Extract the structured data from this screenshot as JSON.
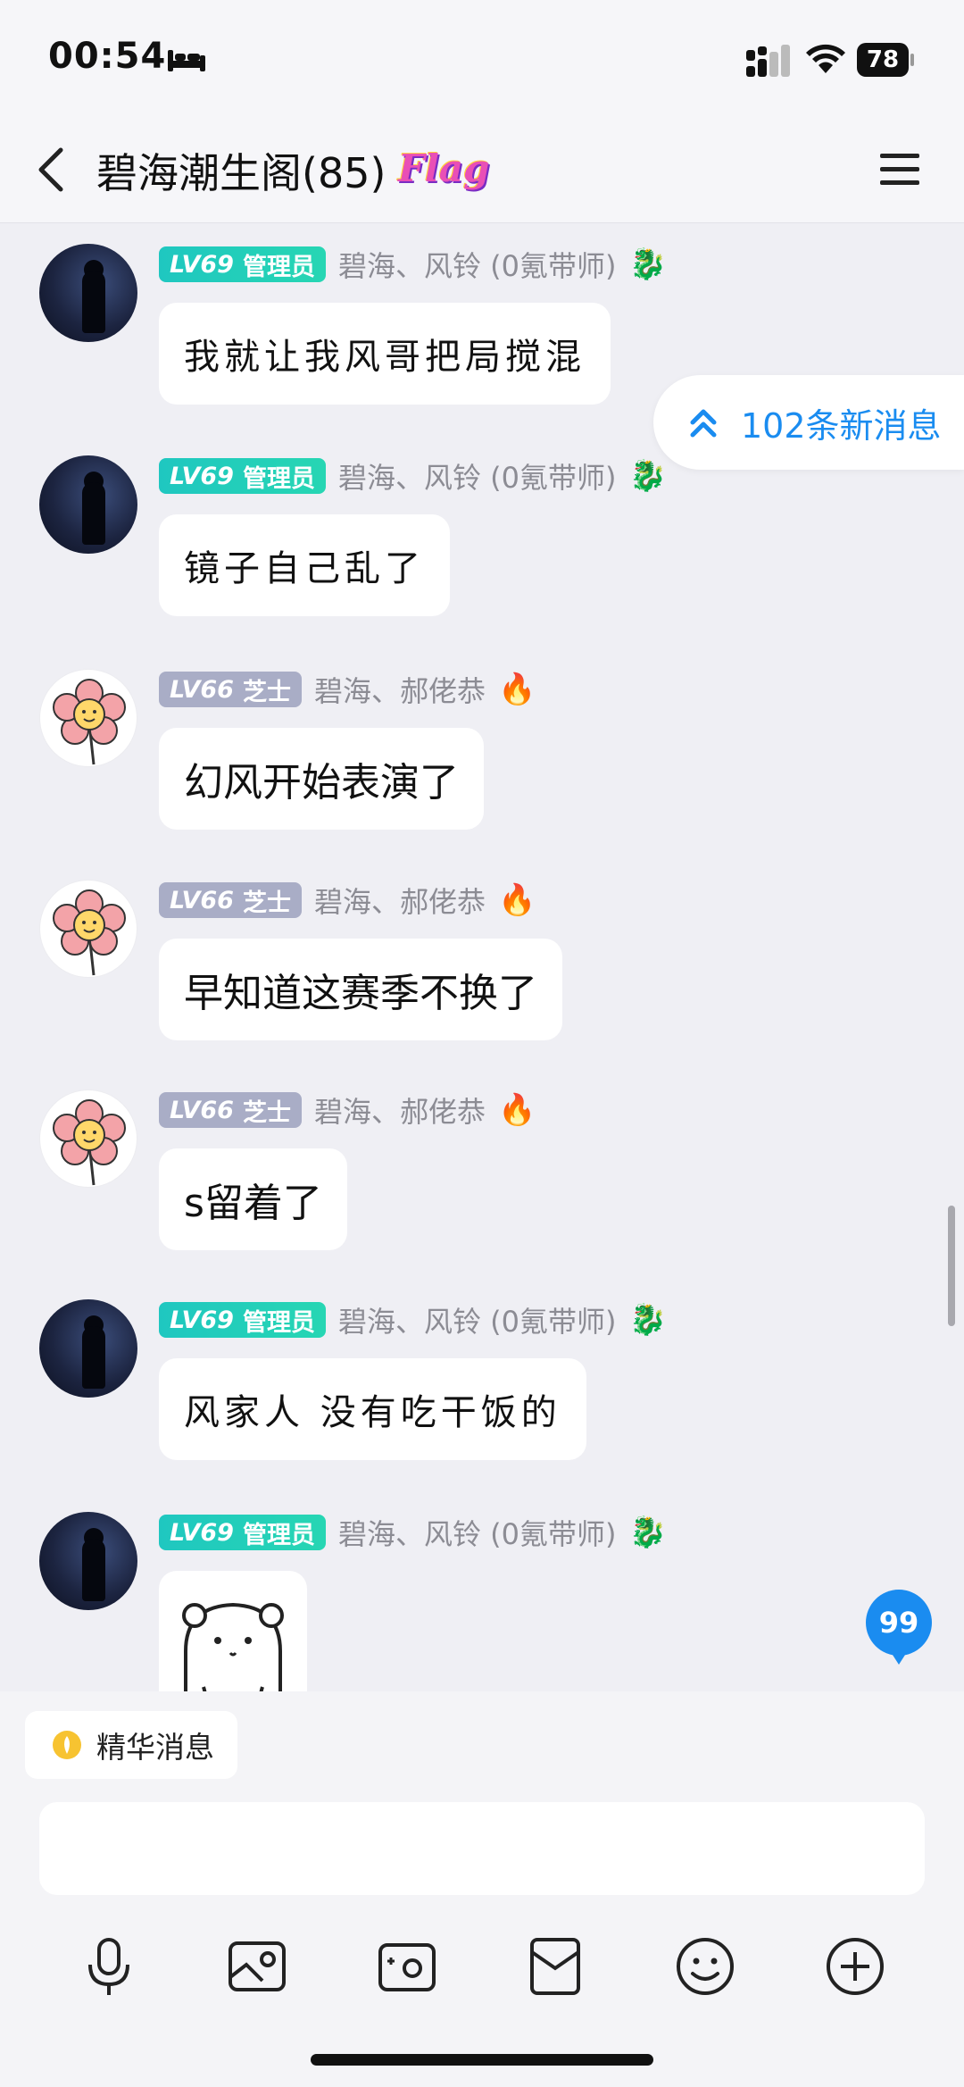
{
  "status_bar": {
    "time": "00:54",
    "battery": "78"
  },
  "header": {
    "title": "碧海潮生阁(85)",
    "flag_badge": "Flag"
  },
  "new_messages_pill": "102条新消息",
  "unread_badge": "99",
  "messages": [
    {
      "level": "LV69",
      "role": "管理员",
      "nickname": "碧海、风铃 (0氪带师)",
      "text": "我就让我风哥把局搅混"
    },
    {
      "level": "LV69",
      "role": "管理员",
      "nickname": "碧海、风铃 (0氪带师)",
      "text": "镜子自己乱了"
    },
    {
      "level": "LV66",
      "role": "芝士",
      "nickname": "碧海、郝佬恭",
      "text": "幻风开始表演了"
    },
    {
      "level": "LV66",
      "role": "芝士",
      "nickname": "碧海、郝佬恭",
      "text": "早知道这赛季不换了"
    },
    {
      "level": "LV66",
      "role": "芝士",
      "nickname": "碧海、郝佬恭",
      "text": "s留着了"
    },
    {
      "level": "LV69",
      "role": "管理员",
      "nickname": "碧海、风铃 (0氪带师)",
      "text": "风家人 没有吃干饭的"
    },
    {
      "level": "LV69",
      "role": "管理员",
      "nickname": "碧海、风铃 (0氪带师)",
      "text": ""
    }
  ],
  "bottom": {
    "essence_label": "精华消息",
    "toolbar_icons": [
      "microphone-icon",
      "image-icon",
      "camera-icon",
      "red-packet-icon",
      "emoji-icon",
      "plus-icon"
    ]
  },
  "colors": {
    "accent_blue": "#1a8cf0",
    "admin_tag": "#1fc7c0",
    "member_tag": "#a9adc6",
    "background": "#efeff4"
  }
}
